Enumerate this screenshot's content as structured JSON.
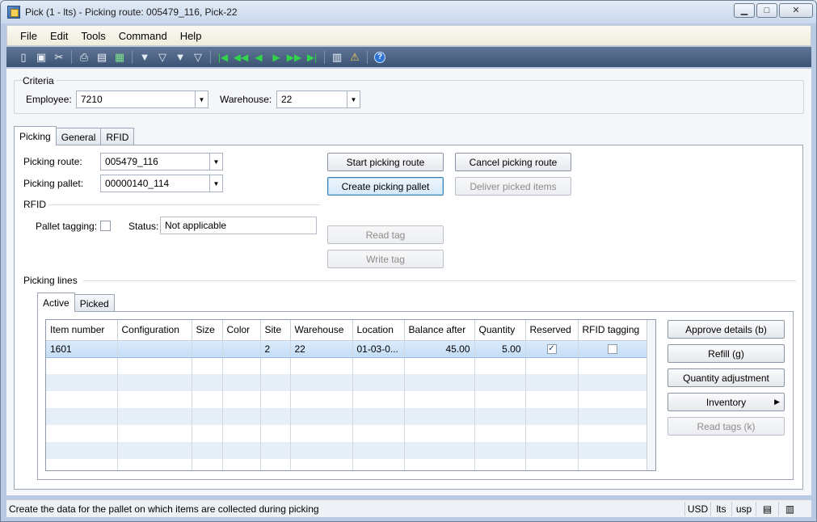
{
  "window": {
    "title": "Pick (1 - lts) - Picking route: 005479_116, Pick-22",
    "controls": {
      "minimize": "▁",
      "maximize": "□",
      "close": "✕"
    }
  },
  "menu": [
    "File",
    "Edit",
    "Tools",
    "Command",
    "Help"
  ],
  "toolbar": {
    "icons": [
      "new-icon",
      "save-icon",
      "delete-icon",
      "print-icon",
      "print-preview-icon",
      "excel-icon",
      "filter-icon",
      "filter-by-selection-icon",
      "advanced-filter-icon",
      "remove-filter-icon",
      "first-record-icon",
      "previous-page-icon",
      "previous-record-icon",
      "next-record-icon",
      "next-page-icon",
      "last-record-icon",
      "attach-document-icon",
      "alert-icon",
      "help-icon"
    ]
  },
  "criteria": {
    "legend": "Criteria",
    "employee_label": "Employee:",
    "employee_value": "7210",
    "warehouse_label": "Warehouse:",
    "warehouse_value": "22"
  },
  "main_tabs": [
    "Picking",
    "General",
    "RFID"
  ],
  "picking": {
    "route_label": "Picking route:",
    "route_value": "005479_116",
    "pallet_label": "Picking pallet:",
    "pallet_value": "00000140_114",
    "rfid_legend": "RFID",
    "pallet_tagging_label": "Pallet tagging:",
    "status_label": "Status:",
    "status_value": "Not applicable",
    "buttons": {
      "start_route": "Start picking route",
      "cancel_route": "Cancel picking route",
      "create_pallet": "Create picking pallet",
      "deliver_items": "Deliver picked items",
      "read_tag": "Read tag",
      "write_tag": "Write tag"
    }
  },
  "picking_lines": {
    "legend": "Picking lines",
    "tabs": [
      "Active",
      "Picked"
    ],
    "columns": [
      "Item number",
      "Configuration",
      "Size",
      "Color",
      "Site",
      "Warehouse",
      "Location",
      "Balance after",
      "Quantity",
      "Reserved",
      "RFID tagging"
    ],
    "rows": [
      {
        "item": "1601",
        "config": "",
        "size": "",
        "color": "",
        "site": "2",
        "warehouse": "22",
        "location": "01-03-0...",
        "balance": "45.00",
        "quantity": "5.00",
        "reserved_mark": "✓",
        "rfid_mark": ""
      }
    ]
  },
  "side_buttons": {
    "approve": "Approve details (b)",
    "refill": "Refill (g)",
    "qty_adjust": "Quantity adjustment",
    "inventory": "Inventory",
    "read_tags": "Read tags (k)"
  },
  "status_bar": {
    "message": "Create the data for the pallet on which items are collected during picking",
    "currency": "USD",
    "company": "lts",
    "layer": "usp"
  }
}
